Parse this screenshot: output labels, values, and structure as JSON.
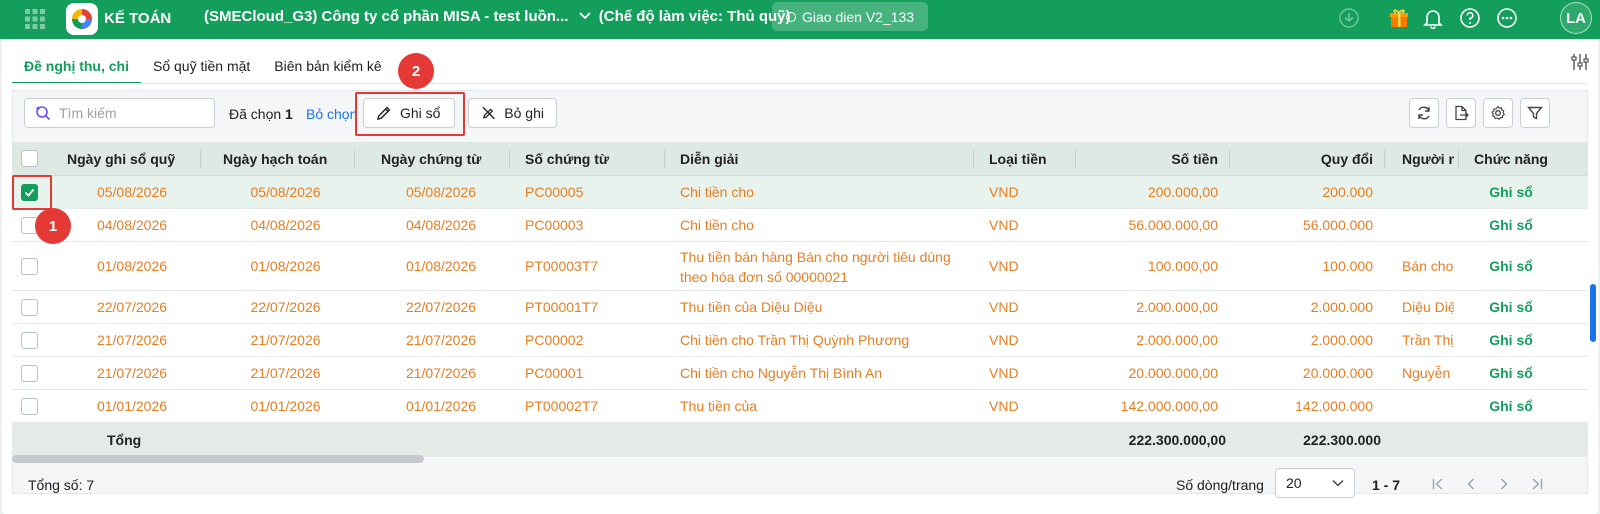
{
  "topbar": {
    "app_name": "KẾ TOÁN",
    "company": "(SMECloud_G3) Công ty cổ phần MISA - test luồn...",
    "mode": "(Chế độ làm việc: Thủ quỹ)",
    "ui_version": "Giao dien V2_133",
    "avatar_initials": "LA",
    "brand_color": "#139e5b"
  },
  "tabs": [
    {
      "label": "Đề nghị thu, chi",
      "active": true
    },
    {
      "label": "Sổ quỹ tiền mặt",
      "active": false
    },
    {
      "label": "Biên bản kiểm kê",
      "active": false
    }
  ],
  "toolbar": {
    "search_placeholder": "Tìm kiếm",
    "selected_prefix": "Đã chọn",
    "selected_count": "1",
    "unselect_label": "Bỏ chọn",
    "post_label": "Ghi sổ",
    "unpost_label": "Bỏ ghi"
  },
  "annotations": {
    "marker_1": "1",
    "marker_2": "2"
  },
  "table": {
    "headers": [
      "Ngày ghi sổ quỹ",
      "Ngày hạch toán",
      "Ngày chứng từ",
      "Số chứng từ",
      "Diễn giải",
      "Loại tiền",
      "Số tiền",
      "Quy đổi",
      "Người n",
      "Chức năng"
    ],
    "rows": [
      {
        "checked": true,
        "fund_date": "05/08/2026",
        "posting_date": "05/08/2026",
        "voucher_date": "05/08/2026",
        "voucher_no": "PC00005",
        "description": "Chi tiền cho",
        "currency": "VND",
        "amount": "200.000,00",
        "converted": "200.000",
        "person": "",
        "action": "Ghi sổ"
      },
      {
        "checked": false,
        "fund_date": "04/08/2026",
        "posting_date": "04/08/2026",
        "voucher_date": "04/08/2026",
        "voucher_no": "PC00003",
        "description": "Chi tiền cho",
        "currency": "VND",
        "amount": "56.000.000,00",
        "converted": "56.000.000",
        "person": "",
        "action": "Ghi sổ"
      },
      {
        "checked": false,
        "fund_date": "01/08/2026",
        "posting_date": "01/08/2026",
        "voucher_date": "01/08/2026",
        "voucher_no": "PT00003T7",
        "description": "Thu tiền bán hàng Bán cho người tiêu dùng theo hóa đơn số 00000021",
        "currency": "VND",
        "amount": "100.000,00",
        "converted": "100.000",
        "person": "Bán cho",
        "action": "Ghi sổ"
      },
      {
        "checked": false,
        "fund_date": "22/07/2026",
        "posting_date": "22/07/2026",
        "voucher_date": "22/07/2026",
        "voucher_no": "PT00001T7",
        "description": "Thu tiền của Diệu Diệu",
        "currency": "VND",
        "amount": "2.000.000,00",
        "converted": "2.000.000",
        "person": "Diệu Diệ",
        "action": "Ghi sổ"
      },
      {
        "checked": false,
        "fund_date": "21/07/2026",
        "posting_date": "21/07/2026",
        "voucher_date": "21/07/2026",
        "voucher_no": "PC00002",
        "description": "Chi tiền cho Trần Thị Quỳnh Phương",
        "currency": "VND",
        "amount": "2.000.000,00",
        "converted": "2.000.000",
        "person": "Trần Thị",
        "action": "Ghi sổ"
      },
      {
        "checked": false,
        "fund_date": "21/07/2026",
        "posting_date": "21/07/2026",
        "voucher_date": "21/07/2026",
        "voucher_no": "PC00001",
        "description": "Chi tiền cho Nguyễn Thị Bình An",
        "currency": "VND",
        "amount": "20.000.000,00",
        "converted": "20.000.000",
        "person": "Nguyễn",
        "action": "Ghi sổ"
      },
      {
        "checked": false,
        "fund_date": "01/01/2026",
        "posting_date": "01/01/2026",
        "voucher_date": "01/01/2026",
        "voucher_no": "PT00002T7",
        "description": "Thu tiền của",
        "currency": "VND",
        "amount": "142.000.000,00",
        "converted": "142.000.000",
        "person": "",
        "action": "Ghi sổ"
      }
    ],
    "footer": {
      "label": "Tổng",
      "amount_total": "222.300.000,00",
      "converted_total": "222.300.000"
    }
  },
  "pagination": {
    "total_label": "Tổng số: 7",
    "rows_per_page_label": "Số dòng/trang",
    "page_size": "20",
    "range": "1 - 7"
  }
}
